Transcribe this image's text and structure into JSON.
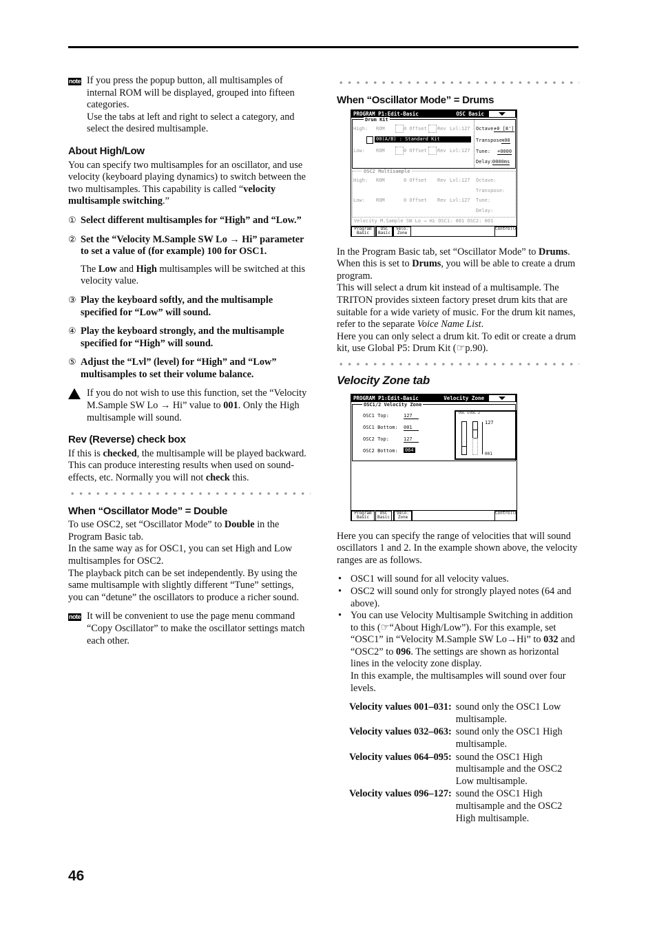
{
  "page_number": "46",
  "left_column": [
    {
      "type": "note",
      "icon": "note-icon",
      "icon_text": "note",
      "paras": [
        [
          "If you press the popup button, all multisamples of internal ROM will be displayed, grouped into fifteen categories."
        ],
        [
          "Use the tabs at left and right to select a category, and select the desired multisample."
        ]
      ]
    },
    {
      "type": "heading",
      "text": "About High/Low"
    },
    {
      "type": "para",
      "runs": [
        "You can specify two multisamples for an oscillator, and use velocity (keyboard playing dynamics) to switch between the two multisamples. This capability is called “",
        {
          "t": "velocity multisample switching",
          "s": "b"
        },
        ".”"
      ]
    },
    {
      "type": "step",
      "num": "①",
      "runs": [
        "Select different multisamples for “High” and “Low.”"
      ]
    },
    {
      "type": "step",
      "num": "②",
      "runs": [
        "Set the “Velocity M.Sample SW Lo → Hi” parameter to set a value of (for example) 100 for OSC1."
      ]
    },
    {
      "type": "sub",
      "runs": [
        "The ",
        {
          "t": "Low",
          "s": "b"
        },
        " and ",
        {
          "t": "High",
          "s": "b"
        },
        " multisamples will be switched at this velocity value."
      ]
    },
    {
      "type": "step",
      "num": "③",
      "runs": [
        "Play the keyboard softly, and the multisample specified for “Low” will sound."
      ]
    },
    {
      "type": "step",
      "num": "④",
      "runs": [
        "Play the keyboard strongly, and the multisample specified for “High” will sound."
      ]
    },
    {
      "type": "step",
      "num": "⑤",
      "runs": [
        "Adjust the “Lvl” (level) for “High” and “Low” multisamples to set their volume balance."
      ]
    },
    {
      "type": "caution",
      "icon": "caution-icon",
      "paras": [
        [
          "If you do not wish to use this function, set the “Velocity M.Sample SW Lo → Hi” value to ",
          {
            "t": "001",
            "s": "b"
          },
          ". Only the High multisample will sound."
        ]
      ]
    },
    {
      "type": "heading",
      "text": "Rev (Reverse) check box"
    },
    {
      "type": "para",
      "runs": [
        "If this is ",
        {
          "t": "checked",
          "s": "b"
        },
        ", the multisample will be played backward. This can produce interesting results when used on sound-effects, etc. Normally you will not ",
        {
          "t": "check",
          "s": "b"
        },
        " this."
      ]
    },
    {
      "type": "dots"
    },
    {
      "type": "heading",
      "text": "When “Oscillator Mode” = Double"
    },
    {
      "type": "para",
      "runs": [
        "To use OSC2, set “Oscillator Mode” to ",
        {
          "t": "Double",
          "s": "b"
        },
        " in the Program Basic tab."
      ],
      "tight": true
    },
    {
      "type": "para",
      "runs": [
        "In the same way as for OSC1, you can set High and Low multisamples for OSC2."
      ],
      "tight": true
    },
    {
      "type": "para",
      "runs": [
        "The playback pitch can be set independently. By using the same multisample with slightly different “Tune” settings, you can “detune” the oscillators to produce a richer sound."
      ]
    },
    {
      "type": "note",
      "icon": "note-icon",
      "icon_text": "note",
      "paras": [
        [
          "It will be convenient to use the page menu command “Copy Oscillator” to make the oscillator settings match each other."
        ]
      ]
    }
  ],
  "right_column": [
    {
      "type": "dots"
    },
    {
      "type": "heading",
      "text": "When “Oscillator Mode” = Drums"
    },
    {
      "type": "lcd_drums"
    },
    {
      "type": "para",
      "runs": [
        "In the Program Basic tab, set “Oscillator Mode” to ",
        {
          "t": "Drums",
          "s": "b"
        },
        ". When this is set to ",
        {
          "t": "Drums",
          "s": "b"
        },
        ", you will be able to create a drum program."
      ],
      "tight": true
    },
    {
      "type": "para",
      "runs": [
        "This will select a drum kit instead of a multisample. The TRITON provides sixteen factory preset drum kits that are suitable for a wide variety of music. For the drum kit names, refer to the separate ",
        {
          "t": "Voice Name List",
          "s": "i"
        },
        "."
      ],
      "tight": true
    },
    {
      "type": "para",
      "runs": [
        "Here you can only select a drum kit. To edit or create a drum kit, use Global P5: Drum Kit (☞p.90)."
      ]
    },
    {
      "type": "dots"
    },
    {
      "type": "italic_heading",
      "text": "Velocity Zone tab"
    },
    {
      "type": "lcd_velo"
    },
    {
      "type": "para",
      "runs": [
        "Here you can specify the range of velocities that will sound oscillators 1 and 2. In the example shown above, the velocity ranges are as follows."
      ]
    },
    {
      "type": "bullets",
      "items": [
        {
          "runs": [
            "OSC1 will sound for all velocity values."
          ]
        },
        {
          "runs": [
            "OSC2 will sound only for strongly played notes (64 and above)."
          ]
        },
        {
          "runs": [
            "You can use Velocity Multisample Switching in addition to this (☞“About High/Low”). For this example, set “OSC1” in “Velocity M.Sample SW Lo→Hi” to ",
            {
              "t": "032",
              "s": "b"
            },
            " and “OSC2” to ",
            {
              "t": "096",
              "s": "b"
            },
            ". The settings are shown as horizontal lines in the velocity zone display."
          ],
          "extra": [
            "In this example, the multisamples will sound over four levels."
          ]
        }
      ]
    },
    {
      "type": "table",
      "rows": [
        {
          "k": "Velocity values 001–031:",
          "v": "sound only the OSC1 Low multisample."
        },
        {
          "k": "Velocity values 032–063:",
          "v": "sound only the OSC1 High multisample."
        },
        {
          "k": "Velocity values 064–095:",
          "v": "sound the OSC1 High multisample and the OSC2 Low multisample."
        },
        {
          "k": "Velocity values 096–127:",
          "v": "sound the OSC1 High multisample and the OSC2 High multisample."
        }
      ]
    }
  ],
  "lcd_drums": {
    "title": "PROGRAM P1:Edit-Basic",
    "page": "OSC Basic",
    "section1": "Drum Kit",
    "high_label": "High:",
    "low_label": "Low:",
    "rom": "ROM",
    "offset": "0 Offset",
    "rev": "Rev",
    "lvl": "Lvl:127",
    "kit": "00(A/B) : Standard Kit",
    "octave_label": "Octave:",
    "octave": "+0 [8']",
    "transpose_label": "Transpose:",
    "transpose": "+00",
    "tune_label": "Tune:",
    "tune": "+0000",
    "delay_label": "Delay:",
    "delay": "0000ms",
    "section2": "OSC2 Multisample",
    "velocity_sw": "Velocity M.Sample SW Lo → Hi  OSC1: 001  OSC2: 001",
    "tabs": [
      "Program Basic",
      "OSC Basic",
      "Velo. Zone",
      "Controller"
    ]
  },
  "lcd_velo": {
    "title": "PROGRAM P1:Edit-Basic",
    "page": "Velocity Zone",
    "section": "OSC1/2 Velocity Zone",
    "fields": [
      {
        "label": "OSC1 Top:",
        "value": "127"
      },
      {
        "label": "OSC1 Bottom:",
        "value": "001"
      },
      {
        "label": "OSC2 Top:",
        "value": "127"
      },
      {
        "label": "OSC2 Bottom:",
        "value": "064"
      }
    ],
    "graph_osc1": "OSC 1",
    "graph_osc2": "OSC 2",
    "graph_top": "127",
    "graph_bottom": "001",
    "tabs": [
      "Program Basic",
      "OSC Basic",
      "Velo. Zone",
      "Controller"
    ]
  }
}
